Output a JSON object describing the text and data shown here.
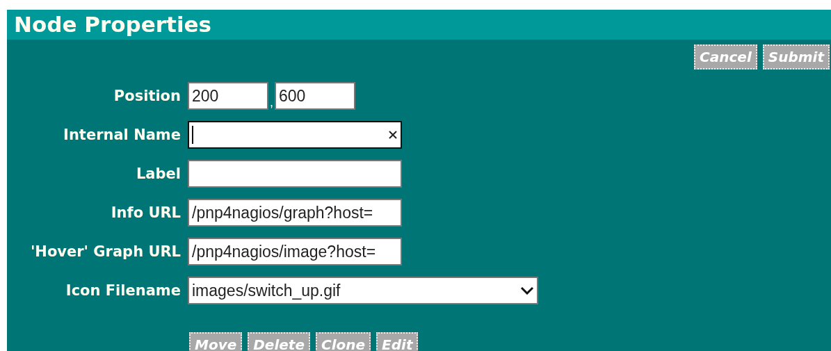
{
  "panel": {
    "title": "Node Properties"
  },
  "top_buttons": [
    {
      "label": "Cancel"
    },
    {
      "label": "Submit"
    }
  ],
  "fields": [
    {
      "kind": "pair",
      "label": "Position",
      "values": [
        "200",
        "600"
      ],
      "separator": ","
    },
    {
      "kind": "text",
      "label": "Internal Name",
      "focused": true,
      "clearable": true
    },
    {
      "kind": "text",
      "label": "Label",
      "focused": false,
      "clearable": false
    },
    {
      "kind": "text",
      "label": "Info URL",
      "value": "/pnp4nagios/graph?host=",
      "focused": false,
      "clearable": false
    },
    {
      "kind": "text",
      "label": "'Hover' Graph URL",
      "value": "/pnp4nagios/image?host=",
      "focused": false,
      "clearable": false
    },
    {
      "kind": "select",
      "label": "Icon Filename",
      "value": "images/switch_up.gif"
    }
  ],
  "bottom_buttons": [
    {
      "label": "Move"
    },
    {
      "label": "Delete"
    },
    {
      "label": "Clone"
    },
    {
      "label": "Edit"
    }
  ]
}
